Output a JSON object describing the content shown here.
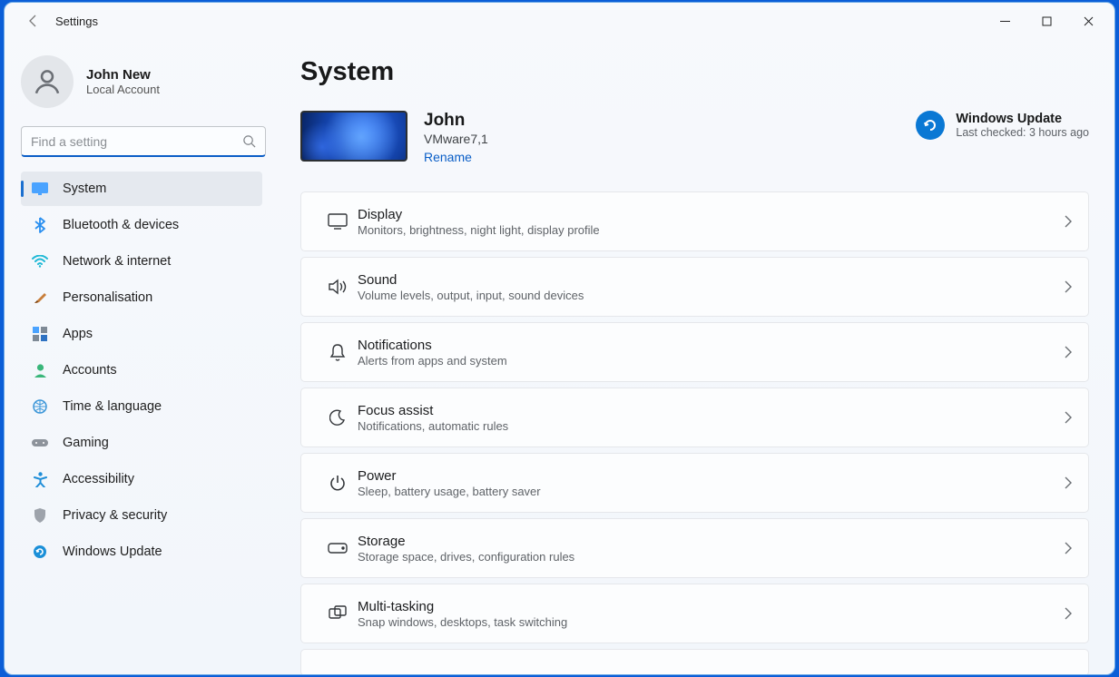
{
  "window": {
    "title": "Settings"
  },
  "profile": {
    "name": "John New",
    "account_type": "Local Account"
  },
  "search": {
    "placeholder": "Find a setting"
  },
  "nav": {
    "items": [
      {
        "label": "System"
      },
      {
        "label": "Bluetooth & devices"
      },
      {
        "label": "Network & internet"
      },
      {
        "label": "Personalisation"
      },
      {
        "label": "Apps"
      },
      {
        "label": "Accounts"
      },
      {
        "label": "Time & language"
      },
      {
        "label": "Gaming"
      },
      {
        "label": "Accessibility"
      },
      {
        "label": "Privacy & security"
      },
      {
        "label": "Windows Update"
      }
    ]
  },
  "page": {
    "title": "System"
  },
  "device": {
    "name": "John",
    "model": "VMware7,1",
    "rename_label": "Rename"
  },
  "windows_update": {
    "title": "Windows Update",
    "status": "Last checked: 3 hours ago"
  },
  "cards": [
    {
      "title": "Display",
      "sub": "Monitors, brightness, night light, display profile"
    },
    {
      "title": "Sound",
      "sub": "Volume levels, output, input, sound devices"
    },
    {
      "title": "Notifications",
      "sub": "Alerts from apps and system"
    },
    {
      "title": "Focus assist",
      "sub": "Notifications, automatic rules"
    },
    {
      "title": "Power",
      "sub": "Sleep, battery usage, battery saver"
    },
    {
      "title": "Storage",
      "sub": "Storage space, drives, configuration rules"
    },
    {
      "title": "Multi-tasking",
      "sub": "Snap windows, desktops, task switching"
    }
  ]
}
